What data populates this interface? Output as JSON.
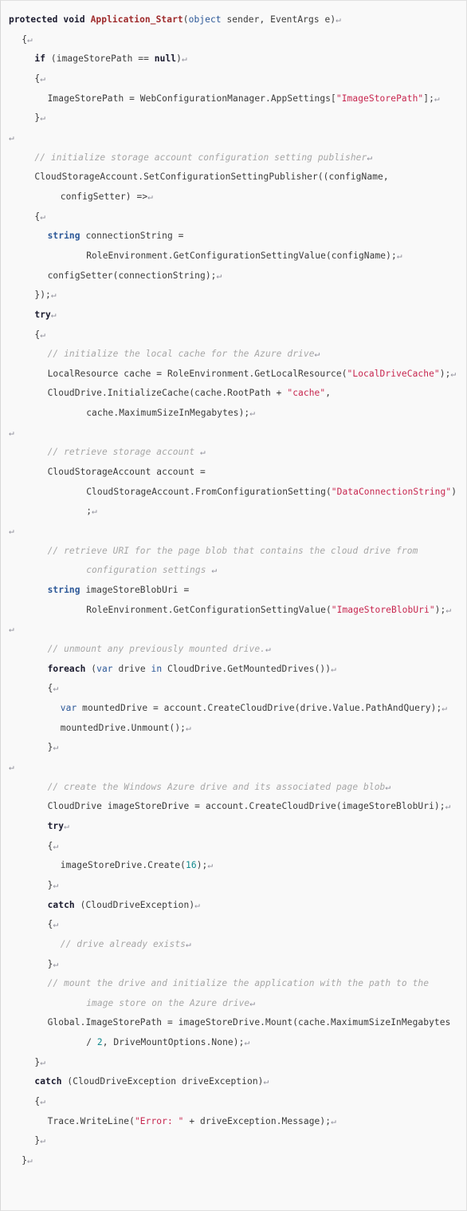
{
  "colors": {
    "background": "#f9f9f9",
    "border": "#e0e0e0",
    "text": "#3a3a3a",
    "keyword": "#1a1a2e",
    "type": "#2b5797",
    "function": "#9e2a2b",
    "string": "#c7254e",
    "number": "#10898c",
    "comment": "#a6a6a6",
    "pilcrow": "#8f8f9a"
  },
  "language": "csharp",
  "pilcrow_glyph": "↵",
  "code": {
    "plain_text": "protected void Application_Start(object sender, EventArgs e)↵\n    {↵\n      if (imageStorePath == null)↵\n      {↵\n        ImageStorePath = WebConfigurationManager.AppSettings[\"ImageStorePath\"];↵\n      }↵\n↵\n      // initialize storage account configuration setting publisher↵\n      CloudStorageAccount.SetConfigurationSettingPublisher((configName, configSetter) =>↵\n      {↵\n        string connectionString = RoleEnvironment.GetConfigurationSettingValue(configName);↵\n        configSetter(connectionString);↵\n      });↵\n      try↵\n      {↵\n        // initialize the local cache for the Azure drive↵\n        LocalResource cache = RoleEnvironment.GetLocalResource(\"LocalDriveCache\");↵\n        CloudDrive.InitializeCache(cache.RootPath + \"cache\", cache.MaximumSizeInMegabytes);↵\n↵\n        // retrieve storage account ↵\n        CloudStorageAccount account = CloudStorageAccount.FromConfigurationSetting(\"DataConnectionString\");↵\n↵\n        // retrieve URI for the page blob that contains the cloud drive from configuration settings ↵\n        string imageStoreBlobUri = RoleEnvironment.GetConfigurationSettingValue(\"ImageStoreBlobUri\");↵\n↵\n        // unmount any previously mounted drive.↵\n        foreach (var drive in CloudDrive.GetMountedDrives())↵\n        {↵\n          var mountedDrive = account.CreateCloudDrive(drive.Value.PathAndQuery);↵\n          mountedDrive.Unmount();↵\n        }↵\n↵\n        // create the Windows Azure drive and its associated page blob↵\n        CloudDrive imageStoreDrive = account.CreateCloudDrive(imageStoreBlobUri);↵\n        try↵\n        {↵\n          imageStoreDrive.Create(16);↵\n        }↵\n        catch (CloudDriveException)↵\n        {↵\n          // drive already exists↵\n        }↵\n        // mount the drive and initialize the application with the path to the image store on the Azure drive↵\n        Global.ImageStorePath = imageStoreDrive.Mount(cache.MaximumSizeInMegabytes / 2, DriveMountOptions.None);↵\n      }↵\n      catch (CloudDriveException driveException)↵\n      {↵\n        Trace.WriteLine(\"Error: \" + driveException.Message);↵\n      }↵\n  }↵",
    "lines": [
      {
        "indent": 0,
        "tokens": [
          {
            "t": "protected",
            "c": "kw"
          },
          {
            "t": " ",
            "c": "plain"
          },
          {
            "t": "void",
            "c": "kw"
          },
          {
            "t": " ",
            "c": "plain"
          },
          {
            "t": "Application_Start",
            "c": "fn"
          },
          {
            "t": "(",
            "c": "plain"
          },
          {
            "t": "object",
            "c": "type"
          },
          {
            "t": " sender, EventArgs e)",
            "c": "plain"
          },
          {
            "t": "↵",
            "c": "pilcrow"
          }
        ]
      },
      {
        "indent": 1,
        "tokens": [
          {
            "t": "{",
            "c": "plain"
          },
          {
            "t": "↵",
            "c": "pilcrow"
          }
        ]
      },
      {
        "indent": 2,
        "tokens": [
          {
            "t": "if",
            "c": "kw"
          },
          {
            "t": " (imageStorePath == ",
            "c": "plain"
          },
          {
            "t": "null",
            "c": "kw"
          },
          {
            "t": ")",
            "c": "plain"
          },
          {
            "t": "↵",
            "c": "pilcrow"
          }
        ]
      },
      {
        "indent": 2,
        "tokens": [
          {
            "t": "{",
            "c": "plain"
          },
          {
            "t": "↵",
            "c": "pilcrow"
          }
        ]
      },
      {
        "indent": 3,
        "tokens": [
          {
            "t": "ImageStorePath = WebConfigurationManager.AppSettings[",
            "c": "plain"
          },
          {
            "t": "\"ImageStorePath\"",
            "c": "str"
          },
          {
            "t": "];",
            "c": "plain"
          },
          {
            "t": "↵",
            "c": "pilcrow"
          }
        ]
      },
      {
        "indent": 2,
        "tokens": [
          {
            "t": "}",
            "c": "plain"
          },
          {
            "t": "↵",
            "c": "pilcrow"
          }
        ]
      },
      {
        "indent": 0,
        "tokens": [
          {
            "t": "↵",
            "c": "pilcrow"
          }
        ]
      },
      {
        "indent": 2,
        "tokens": [
          {
            "t": "// initialize storage account configuration setting publisher",
            "c": "cmt"
          },
          {
            "t": "↵",
            "c": "pilcrow"
          }
        ]
      },
      {
        "indent": 2,
        "tokens": [
          {
            "t": "CloudStorageAccount.SetConfigurationSettingPublisher((configName, configSetter) =>",
            "c": "plain"
          },
          {
            "t": "↵",
            "c": "pilcrow"
          }
        ]
      },
      {
        "indent": 2,
        "tokens": [
          {
            "t": "{",
            "c": "plain"
          },
          {
            "t": "↵",
            "c": "pilcrow"
          }
        ]
      },
      {
        "indent": 3,
        "tokens": [
          {
            "t": "string",
            "c": "typeb"
          },
          {
            "t": " connectionString = RoleEnvironment.GetConfigurationSettingValue(configName);",
            "c": "plain"
          },
          {
            "t": "↵",
            "c": "pilcrow"
          }
        ]
      },
      {
        "indent": 3,
        "tokens": [
          {
            "t": "configSetter(connectionString);",
            "c": "plain"
          },
          {
            "t": "↵",
            "c": "pilcrow"
          }
        ]
      },
      {
        "indent": 2,
        "tokens": [
          {
            "t": "});",
            "c": "plain"
          },
          {
            "t": "↵",
            "c": "pilcrow"
          }
        ]
      },
      {
        "indent": 2,
        "tokens": [
          {
            "t": "try",
            "c": "kw"
          },
          {
            "t": "↵",
            "c": "pilcrow"
          }
        ]
      },
      {
        "indent": 2,
        "tokens": [
          {
            "t": "{",
            "c": "plain"
          },
          {
            "t": "↵",
            "c": "pilcrow"
          }
        ]
      },
      {
        "indent": 3,
        "tokens": [
          {
            "t": "// initialize the local cache for the Azure drive",
            "c": "cmt"
          },
          {
            "t": "↵",
            "c": "pilcrow"
          }
        ]
      },
      {
        "indent": 3,
        "tokens": [
          {
            "t": "LocalResource cache = RoleEnvironment.GetLocalResource(",
            "c": "plain"
          },
          {
            "t": "\"LocalDriveCache\"",
            "c": "str"
          },
          {
            "t": ");",
            "c": "plain"
          },
          {
            "t": "↵",
            "c": "pilcrow"
          }
        ]
      },
      {
        "indent": 3,
        "tokens": [
          {
            "t": "CloudDrive.InitializeCache(cache.RootPath + ",
            "c": "plain"
          },
          {
            "t": "\"cache\"",
            "c": "str"
          },
          {
            "t": ", cache.MaximumSizeInMegabytes);",
            "c": "plain"
          },
          {
            "t": "↵",
            "c": "pilcrow"
          }
        ]
      },
      {
        "indent": 0,
        "tokens": [
          {
            "t": "↵",
            "c": "pilcrow"
          }
        ]
      },
      {
        "indent": 3,
        "tokens": [
          {
            "t": "// retrieve storage account ",
            "c": "cmt"
          },
          {
            "t": "↵",
            "c": "pilcrow"
          }
        ]
      },
      {
        "indent": 3,
        "tokens": [
          {
            "t": "CloudStorageAccount account = CloudStorageAccount.FromConfigurationSetting(",
            "c": "plain"
          },
          {
            "t": "\"DataConnectionString\"",
            "c": "str"
          },
          {
            "t": ");",
            "c": "plain"
          },
          {
            "t": "↵",
            "c": "pilcrow"
          }
        ]
      },
      {
        "indent": 0,
        "tokens": [
          {
            "t": "↵",
            "c": "pilcrow"
          }
        ]
      },
      {
        "indent": 3,
        "tokens": [
          {
            "t": "// retrieve URI for the page blob that contains the cloud drive from configuration settings ",
            "c": "cmt"
          },
          {
            "t": "↵",
            "c": "pilcrow"
          }
        ]
      },
      {
        "indent": 3,
        "tokens": [
          {
            "t": "string",
            "c": "typeb"
          },
          {
            "t": " imageStoreBlobUri = RoleEnvironment.GetConfigurationSettingValue(",
            "c": "plain"
          },
          {
            "t": "\"ImageStoreBlobUri\"",
            "c": "str"
          },
          {
            "t": ");",
            "c": "plain"
          },
          {
            "t": "↵",
            "c": "pilcrow"
          }
        ]
      },
      {
        "indent": 0,
        "tokens": [
          {
            "t": "↵",
            "c": "pilcrow"
          }
        ]
      },
      {
        "indent": 3,
        "tokens": [
          {
            "t": "// unmount any previously mounted drive.",
            "c": "cmt"
          },
          {
            "t": "↵",
            "c": "pilcrow"
          }
        ]
      },
      {
        "indent": 3,
        "tokens": [
          {
            "t": "foreach",
            "c": "kw"
          },
          {
            "t": " (",
            "c": "plain"
          },
          {
            "t": "var",
            "c": "type"
          },
          {
            "t": " drive ",
            "c": "plain"
          },
          {
            "t": "in",
            "c": "type"
          },
          {
            "t": " CloudDrive.GetMountedDrives())",
            "c": "plain"
          },
          {
            "t": "↵",
            "c": "pilcrow"
          }
        ]
      },
      {
        "indent": 3,
        "tokens": [
          {
            "t": "{",
            "c": "plain"
          },
          {
            "t": "↵",
            "c": "pilcrow"
          }
        ]
      },
      {
        "indent": 4,
        "tokens": [
          {
            "t": "var",
            "c": "type"
          },
          {
            "t": " mountedDrive = account.CreateCloudDrive(drive.Value.PathAndQuery);",
            "c": "plain"
          },
          {
            "t": "↵",
            "c": "pilcrow"
          }
        ]
      },
      {
        "indent": 4,
        "tokens": [
          {
            "t": "mountedDrive.Unmount();",
            "c": "plain"
          },
          {
            "t": "↵",
            "c": "pilcrow"
          }
        ]
      },
      {
        "indent": 3,
        "tokens": [
          {
            "t": "}",
            "c": "plain"
          },
          {
            "t": "↵",
            "c": "pilcrow"
          }
        ]
      },
      {
        "indent": 0,
        "tokens": [
          {
            "t": "↵",
            "c": "pilcrow"
          }
        ]
      },
      {
        "indent": 3,
        "tokens": [
          {
            "t": "// create the Windows Azure drive and its associated page blob",
            "c": "cmt"
          },
          {
            "t": "↵",
            "c": "pilcrow"
          }
        ]
      },
      {
        "indent": 3,
        "tokens": [
          {
            "t": "CloudDrive imageStoreDrive = account.CreateCloudDrive(imageStoreBlobUri);",
            "c": "plain"
          },
          {
            "t": "↵",
            "c": "pilcrow"
          }
        ]
      },
      {
        "indent": 3,
        "tokens": [
          {
            "t": "try",
            "c": "kw"
          },
          {
            "t": "↵",
            "c": "pilcrow"
          }
        ]
      },
      {
        "indent": 3,
        "tokens": [
          {
            "t": "{",
            "c": "plain"
          },
          {
            "t": "↵",
            "c": "pilcrow"
          }
        ]
      },
      {
        "indent": 4,
        "tokens": [
          {
            "t": "imageStoreDrive.Create(",
            "c": "plain"
          },
          {
            "t": "16",
            "c": "num"
          },
          {
            "t": ");",
            "c": "plain"
          },
          {
            "t": "↵",
            "c": "pilcrow"
          }
        ]
      },
      {
        "indent": 3,
        "tokens": [
          {
            "t": "}",
            "c": "plain"
          },
          {
            "t": "↵",
            "c": "pilcrow"
          }
        ]
      },
      {
        "indent": 3,
        "tokens": [
          {
            "t": "catch",
            "c": "kw"
          },
          {
            "t": " (CloudDriveException)",
            "c": "plain"
          },
          {
            "t": "↵",
            "c": "pilcrow"
          }
        ]
      },
      {
        "indent": 3,
        "tokens": [
          {
            "t": "{",
            "c": "plain"
          },
          {
            "t": "↵",
            "c": "pilcrow"
          }
        ]
      },
      {
        "indent": 4,
        "tokens": [
          {
            "t": "// drive already exists",
            "c": "cmt"
          },
          {
            "t": "↵",
            "c": "pilcrow"
          }
        ]
      },
      {
        "indent": 3,
        "tokens": [
          {
            "t": "}",
            "c": "plain"
          },
          {
            "t": "↵",
            "c": "pilcrow"
          }
        ]
      },
      {
        "indent": 3,
        "tokens": [
          {
            "t": "// mount the drive and initialize the application with the path to the image store on the Azure drive",
            "c": "cmt"
          },
          {
            "t": "↵",
            "c": "pilcrow"
          }
        ]
      },
      {
        "indent": 3,
        "tokens": [
          {
            "t": "Global.ImageStorePath = imageStoreDrive.Mount(cache.MaximumSizeInMegabytes / ",
            "c": "plain"
          },
          {
            "t": "2",
            "c": "num"
          },
          {
            "t": ", DriveMountOptions.None);",
            "c": "plain"
          },
          {
            "t": "↵",
            "c": "pilcrow"
          }
        ]
      },
      {
        "indent": 2,
        "tokens": [
          {
            "t": "}",
            "c": "plain"
          },
          {
            "t": "↵",
            "c": "pilcrow"
          }
        ]
      },
      {
        "indent": 2,
        "tokens": [
          {
            "t": "catch",
            "c": "kw"
          },
          {
            "t": " (CloudDriveException driveException)",
            "c": "plain"
          },
          {
            "t": "↵",
            "c": "pilcrow"
          }
        ]
      },
      {
        "indent": 2,
        "tokens": [
          {
            "t": "{",
            "c": "plain"
          },
          {
            "t": "↵",
            "c": "pilcrow"
          }
        ]
      },
      {
        "indent": 3,
        "tokens": [
          {
            "t": "Trace.WriteLine(",
            "c": "plain"
          },
          {
            "t": "\"Error: \"",
            "c": "str"
          },
          {
            "t": " + driveException.Message);",
            "c": "plain"
          },
          {
            "t": "↵",
            "c": "pilcrow"
          }
        ]
      },
      {
        "indent": 2,
        "tokens": [
          {
            "t": "}",
            "c": "plain"
          },
          {
            "t": "↵",
            "c": "pilcrow"
          }
        ]
      },
      {
        "indent": 1,
        "tokens": [
          {
            "t": "}",
            "c": "plain"
          },
          {
            "t": "↵",
            "c": "pilcrow"
          }
        ]
      }
    ]
  }
}
